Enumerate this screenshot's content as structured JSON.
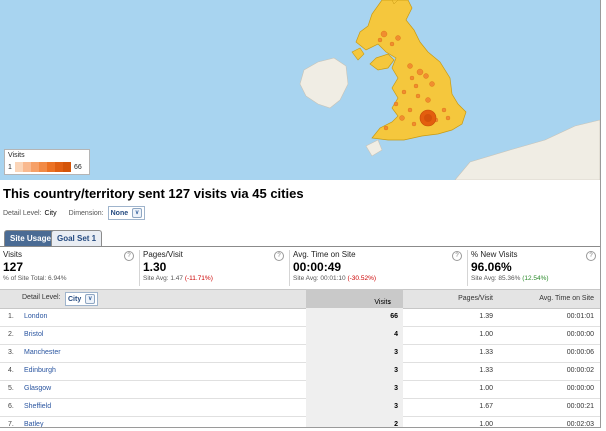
{
  "legend": {
    "title": "Visits",
    "min": "1",
    "max": "66",
    "colors": [
      "#fbd5b8",
      "#f9b98f",
      "#f6a067",
      "#f28a45",
      "#ec7224",
      "#e05f12",
      "#d45408"
    ]
  },
  "headline": "This country/territory sent 127 visits via 45 cities",
  "detail": {
    "level_label": "Detail Level:",
    "level_value": "City",
    "dimension_label": "Dimension:",
    "dimension_value": "None"
  },
  "tabs": [
    {
      "label": "Site Usage"
    },
    {
      "label": "Goal Set 1"
    }
  ],
  "metrics": {
    "visits": {
      "label": "Visits",
      "value": "127",
      "sub": "% of Site Total: 6.94%"
    },
    "pages_visit": {
      "label": "Pages/Visit",
      "value": "1.30",
      "sub_prefix": "Site Avg: 1.47",
      "sub_change": "(-11.71%)"
    },
    "time": {
      "label": "Avg. Time on Site",
      "value": "00:00:49",
      "sub_prefix": "Site Avg: 00:01:10",
      "sub_change": "(-30.52%)"
    },
    "new_visits": {
      "label": "% New Visits",
      "value": "96.06%",
      "sub_prefix": "Site Avg: 85.36%",
      "sub_change": "(12.54%)"
    }
  },
  "help_glyph": "?",
  "table": {
    "detail_label": "Detail Level:",
    "detail_value": "City",
    "columns": {
      "visits": "Visits",
      "sort_arrow": "↓",
      "pages_visit": "Pages/Visit",
      "time": "Avg. Time on Site"
    },
    "rows": [
      {
        "idx": "1.",
        "city": "London",
        "visits": "66",
        "ppv": "1.39",
        "time": "00:01:01"
      },
      {
        "idx": "2.",
        "city": "Bristol",
        "visits": "4",
        "ppv": "1.00",
        "time": "00:00:00"
      },
      {
        "idx": "3.",
        "city": "Manchester",
        "visits": "3",
        "ppv": "1.33",
        "time": "00:00:06"
      },
      {
        "idx": "4.",
        "city": "Edinburgh",
        "visits": "3",
        "ppv": "1.33",
        "time": "00:00:02"
      },
      {
        "idx": "5.",
        "city": "Glasgow",
        "visits": "3",
        "ppv": "1.00",
        "time": "00:00:00"
      },
      {
        "idx": "6.",
        "city": "Sheffield",
        "visits": "3",
        "ppv": "1.67",
        "time": "00:00:21"
      },
      {
        "idx": "7.",
        "city": "Batley",
        "visits": "2",
        "ppv": "1.00",
        "time": "00:02:03"
      }
    ]
  }
}
